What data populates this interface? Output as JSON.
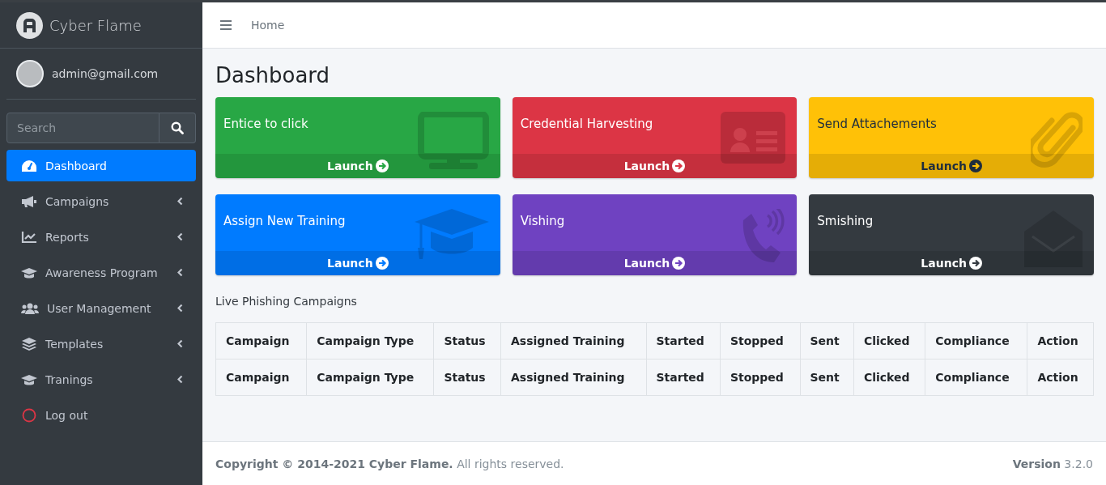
{
  "sidebar": {
    "brand": "Cyber Flame",
    "user": "admin@gmail.com",
    "search": {
      "placeholder": "Search"
    },
    "items": [
      {
        "label": "Dashboard",
        "selected": true,
        "has_submenu": false
      },
      {
        "label": "Campaigns",
        "selected": false,
        "has_submenu": true
      },
      {
        "label": "Reports",
        "selected": false,
        "has_submenu": true
      },
      {
        "label": "Awareness Program",
        "selected": false,
        "has_submenu": true
      },
      {
        "label": "User Management",
        "selected": false,
        "has_submenu": true
      },
      {
        "label": "Templates",
        "selected": false,
        "has_submenu": true
      },
      {
        "label": "Tranings",
        "selected": false,
        "has_submenu": true
      },
      {
        "label": "Log out",
        "selected": false,
        "has_submenu": false
      }
    ]
  },
  "top_bar": {
    "breadcrumb": "Home"
  },
  "page_title": "Dashboard",
  "cards": [
    {
      "title": "Entice to click",
      "action": "Launch",
      "color": "#28a745"
    },
    {
      "title": "Credential Harvesting",
      "action": "Launch",
      "color": "#dc3545"
    },
    {
      "title": "Send Attachements",
      "action": "Launch",
      "color": "#ffc107"
    },
    {
      "title": "Assign New Training",
      "action": "Launch",
      "color": "#007bff"
    },
    {
      "title": "Vishing",
      "action": "Launch",
      "color": "#6f42c1"
    },
    {
      "title": "Smishing",
      "action": "Launch",
      "color": "#343a40"
    }
  ],
  "table": {
    "title": "Live Phishing Campaigns",
    "columns": [
      "Campaign",
      "Campaign Type",
      "Status",
      "Assigned Training",
      "Started",
      "Stopped",
      "Sent",
      "Clicked",
      "Compliance",
      "Action"
    ],
    "footer_columns": [
      "Campaign",
      "Campaign Type",
      "Status",
      "Assigned Training",
      "Started",
      "Stopped",
      "Sent",
      "Clicked",
      "Compliance",
      "Action"
    ]
  },
  "footer": {
    "copyright": "**Copyright © 2014-2021 Cyber Flame.** All rights reserved.",
    "version": "**Version** 3.2.0"
  }
}
